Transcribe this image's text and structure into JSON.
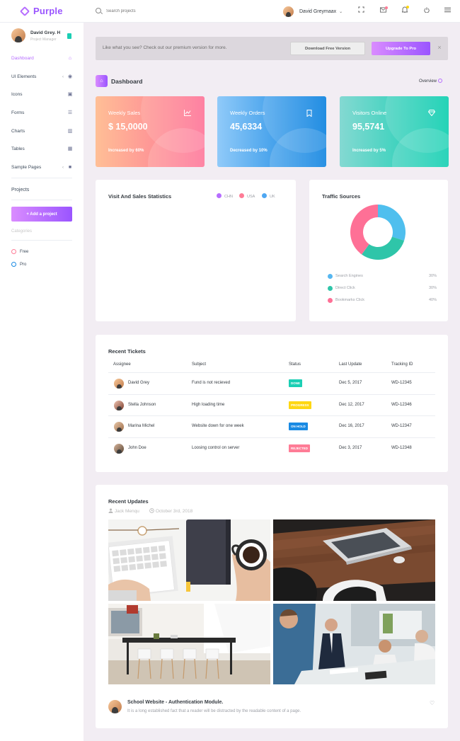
{
  "app": {
    "name": "Purple"
  },
  "topbar": {
    "search_placeholder": "Search projects",
    "user_name": "David Greymaax",
    "caret": "⌄",
    "icons": [
      "fullscreen-icon",
      "mail-icon",
      "bell-icon",
      "power-icon",
      "menu-icon"
    ]
  },
  "sidebar": {
    "profile_name": "David Grey. H",
    "profile_role": "Project Manager",
    "items": [
      {
        "label": "Dashboard",
        "icon": "⌂",
        "active": true
      },
      {
        "label": "UI Elements",
        "icon": "◉",
        "arrow": "‹"
      },
      {
        "label": "Icons",
        "icon": "▣"
      },
      {
        "label": "Forms",
        "icon": "☰"
      },
      {
        "label": "Charts",
        "icon": "▥"
      },
      {
        "label": "Tables",
        "icon": "▦"
      },
      {
        "label": "Sample Pages",
        "icon": "■",
        "arrow": "‹"
      }
    ],
    "projects_label": "Projects",
    "add_project": "+ Add a project",
    "categories_label": "Categories",
    "categories": [
      {
        "label": "Free",
        "color": "#fe7c96"
      },
      {
        "label": "Pro",
        "color": "#198ae3"
      }
    ]
  },
  "banner": {
    "text": "Like what you see? Check out our premium version for more.",
    "download_label": "Download Free Version",
    "upgrade_label": "Upgrade To Pro",
    "close": "×"
  },
  "dashboard": {
    "title": "Dashboard",
    "overview_label": "Overview"
  },
  "stats": [
    {
      "label": "Weekly Sales",
      "value": "$ 15,0000",
      "sub": "Increased by 60%",
      "icon": "chart-line-icon",
      "from": "#ffbf96",
      "to": "#fe7096"
    },
    {
      "label": "Weekly Orders",
      "value": "45,6334",
      "sub": "Decreased by 10%",
      "icon": "bookmark-icon",
      "from": "#90caf9",
      "to": "#047edf"
    },
    {
      "label": "Visitors Online",
      "value": "95,5741",
      "sub": "Increased by 5%",
      "icon": "diamond-icon",
      "from": "#84d9d2",
      "to": "#07cdae"
    }
  ],
  "visit_chart": {
    "title": "Visit And Sales Statistics",
    "legend": [
      {
        "label": "CHN",
        "color": "#b66dff"
      },
      {
        "label": "USA",
        "color": "#fe7c96"
      },
      {
        "label": "UK",
        "color": "#4ea7f2"
      }
    ]
  },
  "traffic": {
    "title": "Traffic Sources",
    "chart_data": {
      "type": "pie",
      "categories": [
        "Search Engines",
        "Direct Click",
        "Bookmarks Click"
      ],
      "values": [
        30,
        30,
        40
      ],
      "colors": [
        "#4fbfee",
        "#2fc5a9",
        "#fe7096"
      ]
    },
    "items": [
      {
        "label": "Search Engines",
        "value": "30%",
        "color": "#56b7f0"
      },
      {
        "label": "Direct Click",
        "value": "30%",
        "color": "#2fc5a9"
      },
      {
        "label": "Bookmarks Click",
        "value": "40%",
        "color": "#fe7096"
      }
    ]
  },
  "tickets": {
    "title": "Recent Tickets",
    "headers": [
      "Assignee",
      "Subject",
      "Status",
      "Last Update",
      "Tracking ID"
    ],
    "rows": [
      {
        "assignee": "David Grey",
        "subject": "Fund is not recieved",
        "status": "DONE",
        "status_color": "#1bcfb4",
        "date": "Dec 5, 2017",
        "tracking": "WD-12345"
      },
      {
        "assignee": "Stella Johnson",
        "subject": "High loading time",
        "status": "PROGRESS",
        "status_color": "#fed713",
        "date": "Dec 12, 2017",
        "tracking": "WD-12346"
      },
      {
        "assignee": "Marina Michel",
        "subject": "Website down for one week",
        "status": "ON HOLD",
        "status_color": "#198ae3",
        "date": "Dec 16, 2017",
        "tracking": "WD-12347"
      },
      {
        "assignee": "John Doe",
        "subject": "Loosing control on server",
        "status": "REJECTED",
        "status_color": "#fe7c96",
        "date": "Dec 3, 2017",
        "tracking": "WD-12348"
      }
    ]
  },
  "updates": {
    "title": "Recent Updates",
    "author": "Jack Menqu",
    "date": "October 3rd, 2018",
    "post_title": "School Website - Authentication Module.",
    "post_text": "It is a long established fact that a reader will be distracted by the readable content of a page."
  }
}
